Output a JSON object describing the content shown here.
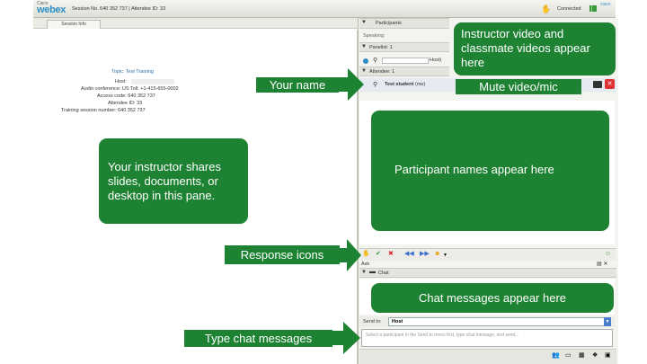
{
  "topbar": {
    "cisco_label": "Cisco",
    "logo_text": "webex",
    "session_text": "Session No. 640 352 737 | Attendee ID: 33",
    "connected_label": "Connected",
    "cisco_right": "cisco"
  },
  "left_tab": {
    "label": "Session Info"
  },
  "session_info": {
    "topic": "Topic: Test Training",
    "host": "Host:",
    "audio": "Audio conference: US Toll: +1-415-655-0002",
    "access_code": "Access code: 640 352 737",
    "attendee_id": "Attendee ID: 33",
    "training_session": "Training session number: 640 352 737"
  },
  "right_panel": {
    "participants_header": "Participants",
    "speaking_label": "Speaking:",
    "panelists_label": "Panelist: 1",
    "panelist_suffix": "Host)",
    "attendees_label": "Attendee: 1",
    "attendee_name": "Test student",
    "attendee_suffix": "(me)",
    "ask_label": "Ask",
    "chat_header": "Chat",
    "send_to_label": "Send to:",
    "send_to_value": "Host",
    "chat_placeholder": "Select a participant in the Send to menu first, type chat message, and send..."
  },
  "annotations": {
    "your_name": "Your name",
    "instructor_video": "Instructor video and classmate videos appear here",
    "mute_video": "Mute video/mic",
    "instructor_shares": "Your instructor shares slides, documents, or desktop in this pane.",
    "participant_names": "Participant names appear here",
    "response_icons": "Response icons",
    "chat_messages": "Chat messages appear here",
    "type_chat": "Type chat messages"
  },
  "colors": {
    "annotation_green": "#1e8233",
    "webex_blue": "#2e8cc4"
  }
}
